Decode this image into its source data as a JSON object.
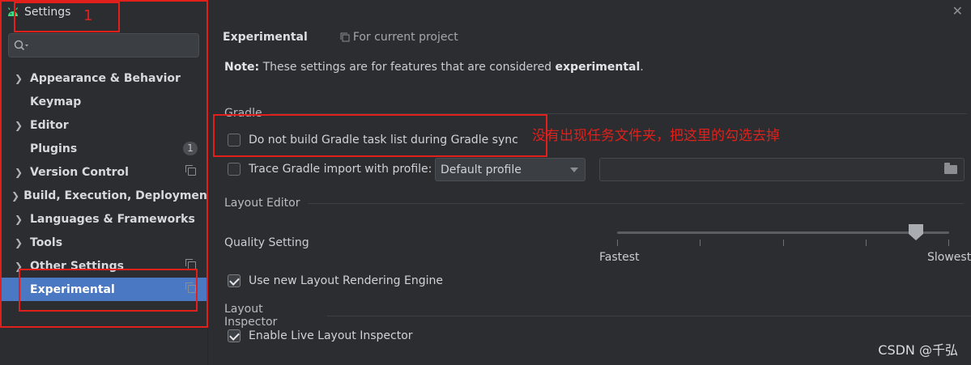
{
  "window": {
    "title": "Settings"
  },
  "sidebar": {
    "search_placeholder": "",
    "items": [
      {
        "label": "Appearance & Behavior",
        "expandable": true
      },
      {
        "label": "Keymap",
        "expandable": false
      },
      {
        "label": "Editor",
        "expandable": true
      },
      {
        "label": "Plugins",
        "expandable": false,
        "badge": "1"
      },
      {
        "label": "Version Control",
        "expandable": true,
        "project_icon": true
      },
      {
        "label": "Build, Execution, Deployment",
        "expandable": true
      },
      {
        "label": "Languages & Frameworks",
        "expandable": true
      },
      {
        "label": "Tools",
        "expandable": true
      },
      {
        "label": "Other Settings",
        "expandable": true,
        "project_icon": true
      },
      {
        "label": "Experimental",
        "expandable": false,
        "project_icon": true,
        "selected": true
      }
    ]
  },
  "main": {
    "title": "Experimental",
    "scope": "For current project",
    "note_prefix": "Note:",
    "note_text": " These settings are for features that are considered ",
    "note_bold": "experimental",
    "note_suffix": ".",
    "gradle": {
      "section": "Gradle",
      "do_not_build_label": "Do not build Gradle task list during Gradle sync",
      "do_not_build_checked": false,
      "trace_label": "Trace Gradle import with profile:",
      "trace_checked": false,
      "profile_value": "Default profile",
      "profile_path": ""
    },
    "layout_editor": {
      "section": "Layout Editor",
      "quality_label": "Quality Setting",
      "quality_min_label": "Fastest",
      "quality_max_label": "Slowest",
      "quality_value": 0.9,
      "ticks": 5,
      "rendering_engine_label": "Use new Layout Rendering Engine",
      "rendering_engine_checked": true
    },
    "layout_inspector": {
      "section": "Layout Inspector",
      "live_label": "Enable Live Layout Inspector",
      "live_checked": true
    }
  },
  "annotations": {
    "marker_number": "1",
    "hint_text": "没有出现任务文件夹，把这里的勾选去掉"
  },
  "watermark": "CSDN @千弘",
  "colors": {
    "selection": "#4a78c2",
    "annotation": "#e2201b",
    "background": "#2b2d30"
  }
}
